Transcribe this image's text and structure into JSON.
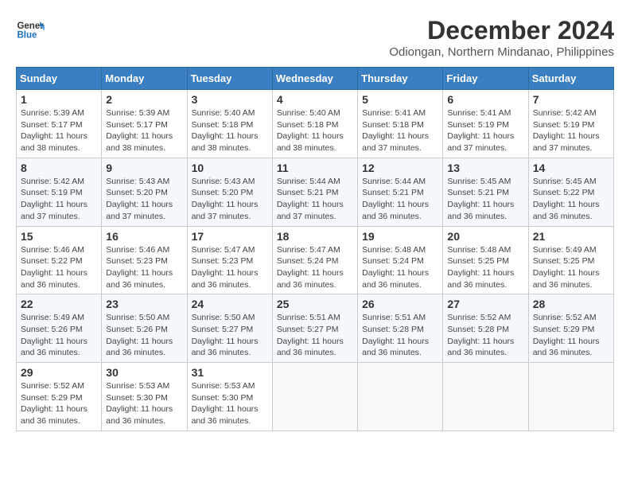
{
  "logo": {
    "line1": "General",
    "line2": "Blue"
  },
  "title": "December 2024",
  "location": "Odiongan, Northern Mindanao, Philippines",
  "days_of_week": [
    "Sunday",
    "Monday",
    "Tuesday",
    "Wednesday",
    "Thursday",
    "Friday",
    "Saturday"
  ],
  "weeks": [
    [
      {
        "day": "1",
        "sunrise": "Sunrise: 5:39 AM",
        "sunset": "Sunset: 5:17 PM",
        "daylight": "Daylight: 11 hours and 38 minutes."
      },
      {
        "day": "2",
        "sunrise": "Sunrise: 5:39 AM",
        "sunset": "Sunset: 5:17 PM",
        "daylight": "Daylight: 11 hours and 38 minutes."
      },
      {
        "day": "3",
        "sunrise": "Sunrise: 5:40 AM",
        "sunset": "Sunset: 5:18 PM",
        "daylight": "Daylight: 11 hours and 38 minutes."
      },
      {
        "day": "4",
        "sunrise": "Sunrise: 5:40 AM",
        "sunset": "Sunset: 5:18 PM",
        "daylight": "Daylight: 11 hours and 38 minutes."
      },
      {
        "day": "5",
        "sunrise": "Sunrise: 5:41 AM",
        "sunset": "Sunset: 5:18 PM",
        "daylight": "Daylight: 11 hours and 37 minutes."
      },
      {
        "day": "6",
        "sunrise": "Sunrise: 5:41 AM",
        "sunset": "Sunset: 5:19 PM",
        "daylight": "Daylight: 11 hours and 37 minutes."
      },
      {
        "day": "7",
        "sunrise": "Sunrise: 5:42 AM",
        "sunset": "Sunset: 5:19 PM",
        "daylight": "Daylight: 11 hours and 37 minutes."
      }
    ],
    [
      {
        "day": "8",
        "sunrise": "Sunrise: 5:42 AM",
        "sunset": "Sunset: 5:19 PM",
        "daylight": "Daylight: 11 hours and 37 minutes."
      },
      {
        "day": "9",
        "sunrise": "Sunrise: 5:43 AM",
        "sunset": "Sunset: 5:20 PM",
        "daylight": "Daylight: 11 hours and 37 minutes."
      },
      {
        "day": "10",
        "sunrise": "Sunrise: 5:43 AM",
        "sunset": "Sunset: 5:20 PM",
        "daylight": "Daylight: 11 hours and 37 minutes."
      },
      {
        "day": "11",
        "sunrise": "Sunrise: 5:44 AM",
        "sunset": "Sunset: 5:21 PM",
        "daylight": "Daylight: 11 hours and 37 minutes."
      },
      {
        "day": "12",
        "sunrise": "Sunrise: 5:44 AM",
        "sunset": "Sunset: 5:21 PM",
        "daylight": "Daylight: 11 hours and 36 minutes."
      },
      {
        "day": "13",
        "sunrise": "Sunrise: 5:45 AM",
        "sunset": "Sunset: 5:21 PM",
        "daylight": "Daylight: 11 hours and 36 minutes."
      },
      {
        "day": "14",
        "sunrise": "Sunrise: 5:45 AM",
        "sunset": "Sunset: 5:22 PM",
        "daylight": "Daylight: 11 hours and 36 minutes."
      }
    ],
    [
      {
        "day": "15",
        "sunrise": "Sunrise: 5:46 AM",
        "sunset": "Sunset: 5:22 PM",
        "daylight": "Daylight: 11 hours and 36 minutes."
      },
      {
        "day": "16",
        "sunrise": "Sunrise: 5:46 AM",
        "sunset": "Sunset: 5:23 PM",
        "daylight": "Daylight: 11 hours and 36 minutes."
      },
      {
        "day": "17",
        "sunrise": "Sunrise: 5:47 AM",
        "sunset": "Sunset: 5:23 PM",
        "daylight": "Daylight: 11 hours and 36 minutes."
      },
      {
        "day": "18",
        "sunrise": "Sunrise: 5:47 AM",
        "sunset": "Sunset: 5:24 PM",
        "daylight": "Daylight: 11 hours and 36 minutes."
      },
      {
        "day": "19",
        "sunrise": "Sunrise: 5:48 AM",
        "sunset": "Sunset: 5:24 PM",
        "daylight": "Daylight: 11 hours and 36 minutes."
      },
      {
        "day": "20",
        "sunrise": "Sunrise: 5:48 AM",
        "sunset": "Sunset: 5:25 PM",
        "daylight": "Daylight: 11 hours and 36 minutes."
      },
      {
        "day": "21",
        "sunrise": "Sunrise: 5:49 AM",
        "sunset": "Sunset: 5:25 PM",
        "daylight": "Daylight: 11 hours and 36 minutes."
      }
    ],
    [
      {
        "day": "22",
        "sunrise": "Sunrise: 5:49 AM",
        "sunset": "Sunset: 5:26 PM",
        "daylight": "Daylight: 11 hours and 36 minutes."
      },
      {
        "day": "23",
        "sunrise": "Sunrise: 5:50 AM",
        "sunset": "Sunset: 5:26 PM",
        "daylight": "Daylight: 11 hours and 36 minutes."
      },
      {
        "day": "24",
        "sunrise": "Sunrise: 5:50 AM",
        "sunset": "Sunset: 5:27 PM",
        "daylight": "Daylight: 11 hours and 36 minutes."
      },
      {
        "day": "25",
        "sunrise": "Sunrise: 5:51 AM",
        "sunset": "Sunset: 5:27 PM",
        "daylight": "Daylight: 11 hours and 36 minutes."
      },
      {
        "day": "26",
        "sunrise": "Sunrise: 5:51 AM",
        "sunset": "Sunset: 5:28 PM",
        "daylight": "Daylight: 11 hours and 36 minutes."
      },
      {
        "day": "27",
        "sunrise": "Sunrise: 5:52 AM",
        "sunset": "Sunset: 5:28 PM",
        "daylight": "Daylight: 11 hours and 36 minutes."
      },
      {
        "day": "28",
        "sunrise": "Sunrise: 5:52 AM",
        "sunset": "Sunset: 5:29 PM",
        "daylight": "Daylight: 11 hours and 36 minutes."
      }
    ],
    [
      {
        "day": "29",
        "sunrise": "Sunrise: 5:52 AM",
        "sunset": "Sunset: 5:29 PM",
        "daylight": "Daylight: 11 hours and 36 minutes."
      },
      {
        "day": "30",
        "sunrise": "Sunrise: 5:53 AM",
        "sunset": "Sunset: 5:30 PM",
        "daylight": "Daylight: 11 hours and 36 minutes."
      },
      {
        "day": "31",
        "sunrise": "Sunrise: 5:53 AM",
        "sunset": "Sunset: 5:30 PM",
        "daylight": "Daylight: 11 hours and 36 minutes."
      },
      null,
      null,
      null,
      null
    ]
  ]
}
